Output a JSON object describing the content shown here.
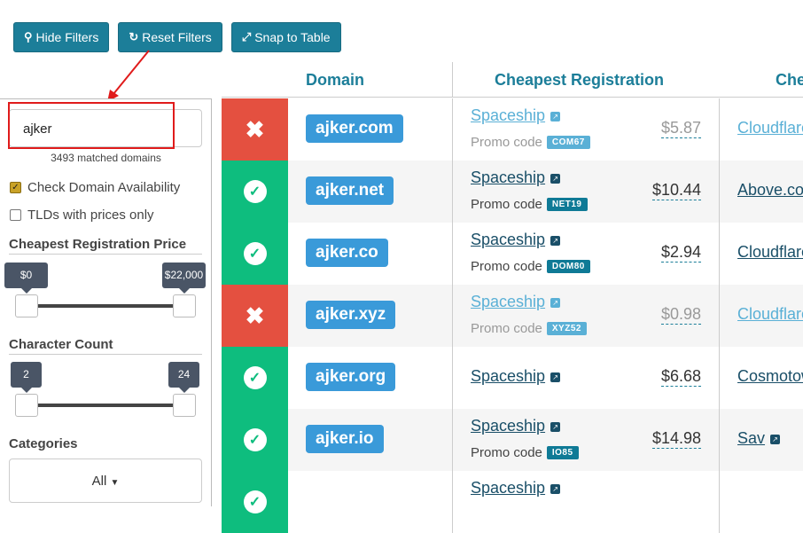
{
  "toolbar": {
    "hide_filters": "Hide Filters",
    "reset_filters": "Reset Filters",
    "snap_to_table": "Snap to Table"
  },
  "sidebar": {
    "search_value": "ajker",
    "matched": "3493 matched domains",
    "check_availability": "Check Domain Availability",
    "tlds_with_prices": "TLDs with prices only",
    "price_title": "Cheapest Registration Price",
    "price_min": "$0",
    "price_max": "$22,000",
    "char_title": "Character Count",
    "char_min": "2",
    "char_max": "24",
    "categories_title": "Categories",
    "categories_value": "All"
  },
  "table": {
    "headers": {
      "domain": "Domain",
      "cheapest": "Cheapest Registration",
      "next": "Che"
    },
    "rows": [
      {
        "available": false,
        "domain": "ajker.com",
        "registrar": "Spaceship",
        "promo_label": "Promo code",
        "code": "COM67",
        "price": "$5.87",
        "next": "Cloudflare"
      },
      {
        "available": true,
        "domain": "ajker.net",
        "registrar": "Spaceship",
        "promo_label": "Promo code",
        "code": "NET19",
        "price": "$10.44",
        "next": "Above.co"
      },
      {
        "available": true,
        "domain": "ajker.co",
        "registrar": "Spaceship",
        "promo_label": "Promo code",
        "code": "DOM80",
        "price": "$2.94",
        "next": "Cloudflare"
      },
      {
        "available": false,
        "domain": "ajker.xyz",
        "registrar": "Spaceship",
        "promo_label": "Promo code",
        "code": "XYZ52",
        "price": "$0.98",
        "next": "Cloudflare"
      },
      {
        "available": true,
        "domain": "ajker.org",
        "registrar": "Spaceship",
        "promo_label": "",
        "code": "",
        "price": "$6.68",
        "next": "Cosmotow"
      },
      {
        "available": true,
        "domain": "ajker.io",
        "registrar": "Spaceship",
        "promo_label": "Promo code",
        "code": "IO85",
        "price": "$14.98",
        "next": "Sav"
      },
      {
        "available": true,
        "domain": "",
        "registrar": "Spaceship",
        "promo_label": "",
        "code": "",
        "price": "",
        "next": ""
      }
    ]
  },
  "colors": {
    "accent": "#1c7e99",
    "available": "#0ebd7e",
    "taken": "#e45040",
    "domain_tag": "#3a9ad9",
    "highlight": "#e01b1b"
  }
}
